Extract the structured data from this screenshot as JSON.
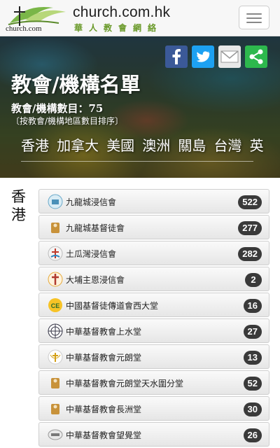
{
  "header": {
    "logo_small": "church.com",
    "brand_title": "church.com.hk",
    "brand_subtitle": "華人教會網絡",
    "menu_icon": "hamburger-icon"
  },
  "share": [
    {
      "icon": "facebook-icon",
      "color": "#3b5998"
    },
    {
      "icon": "twitter-icon",
      "color": "#1da1f2"
    },
    {
      "icon": "mail-icon",
      "color": "#e8e8e8"
    },
    {
      "icon": "share-icon",
      "color": "#2db84d"
    }
  ],
  "hero": {
    "title": "教會/機構名單",
    "count": "教會/機構數目：75",
    "note": "〔按教會/機構地區數目排序〕",
    "regions": [
      "香港",
      "加拿大",
      "美國",
      "澳洲",
      "關島",
      "台灣",
      "英"
    ]
  },
  "section": {
    "label": "香港"
  },
  "items": [
    {
      "name": "九龍城浸信會",
      "count": "522",
      "icon": "church-logo-icon"
    },
    {
      "name": "九龍城基督徒會",
      "count": "277",
      "icon": "church-logo-icon"
    },
    {
      "name": "土瓜灣浸信會",
      "count": "282",
      "icon": "church-logo-icon"
    },
    {
      "name": "大埔主恩浸信會",
      "count": "2",
      "icon": "cross-logo-icon"
    },
    {
      "name": "中國基督徒傳道會西大堂",
      "count": "16",
      "icon": "church-logo-icon"
    },
    {
      "name": "中華基督教會上水堂",
      "count": "27",
      "icon": "church-logo-icon"
    },
    {
      "name": "中華基督教會元朗堂",
      "count": "13",
      "icon": "church-logo-icon"
    },
    {
      "name": "中華基督教會元朗堂天水圍分堂",
      "count": "52",
      "icon": "church-logo-icon"
    },
    {
      "name": "中華基督教會長洲堂",
      "count": "30",
      "icon": "church-logo-icon"
    },
    {
      "name": "中華基督教會望覺堂",
      "count": "26",
      "icon": "church-logo-icon"
    }
  ]
}
